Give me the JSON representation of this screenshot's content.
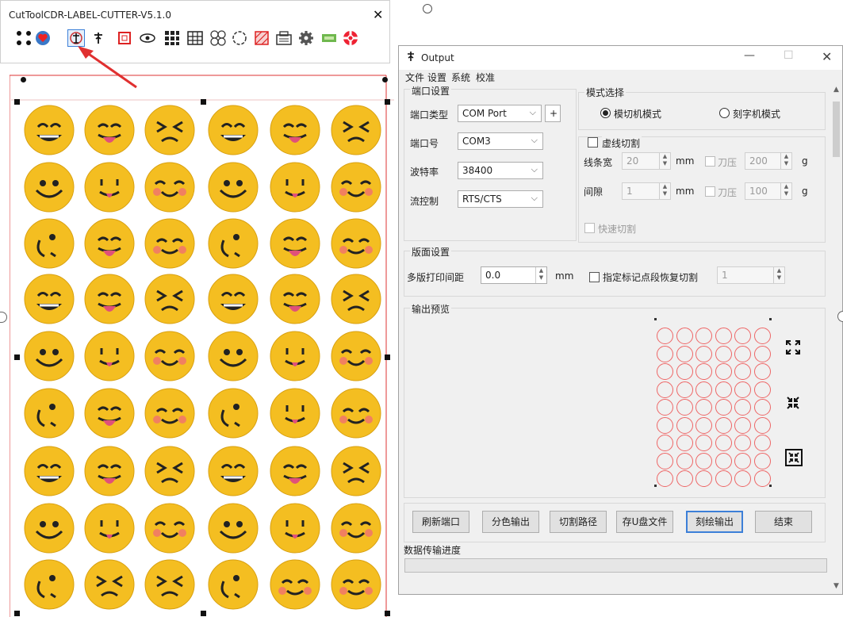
{
  "toolbar_window": {
    "title": "CutToolCDR-LABEL-CUTTER-V5.1.0",
    "close": "✕",
    "icons": [
      "grid-dots-icon",
      "heart-icon",
      "output-icon",
      "cutter-icon",
      "rectangle-icon",
      "eye-icon",
      "barcode-icon",
      "table-icon",
      "circles-icon",
      "circle-dashed-icon",
      "hatch-icon",
      "print-icon",
      "gear-icon",
      "chip-icon",
      "lifebuoy-icon"
    ]
  },
  "output_window": {
    "title": "Output",
    "menu": [
      "文件",
      "设置",
      "系统",
      "校准"
    ],
    "port": {
      "group_title": "端口设置",
      "type_label": "端口类型",
      "type_value": "COM Port",
      "plus": "+",
      "port_label": "端口号",
      "port_value": "COM3",
      "baud_label": "波特率",
      "baud_value": "38400",
      "flow_label": "流控制",
      "flow_value": "RTS/CTS"
    },
    "mode": {
      "group_title": "模式选择",
      "die_cut": "模切机模式",
      "engraver": "刻字机模式",
      "dashed_cut": "虚线切割",
      "line_width_label": "线条宽",
      "line_width_value": "20",
      "gap_label": "间隙",
      "gap_value": "1",
      "unit_mm": "mm",
      "pressure_label": "刀压",
      "pressure1_value": "200",
      "pressure2_value": "100",
      "unit_g": "g",
      "quick_cut": "快速切割"
    },
    "layout": {
      "group_title": "版面设置",
      "multi_label": "多版打印间距",
      "multi_value": "0.0",
      "unit_mm": "mm",
      "mark_resume": "指定标记点段恢复切割",
      "mark_value": "1"
    },
    "preview": {
      "group_title": "输出预览"
    },
    "buttons": [
      "刷新端口",
      "分色输出",
      "切割路径",
      "存U盘文件",
      "刻绘输出",
      "结束"
    ],
    "progress_label": "数据传输进度",
    "progress": 0
  },
  "colors": {
    "accent": "#3c7fd8",
    "emoji_face": "#f4be21",
    "preview_circle": "#e66666",
    "arrow": "#e03030"
  }
}
